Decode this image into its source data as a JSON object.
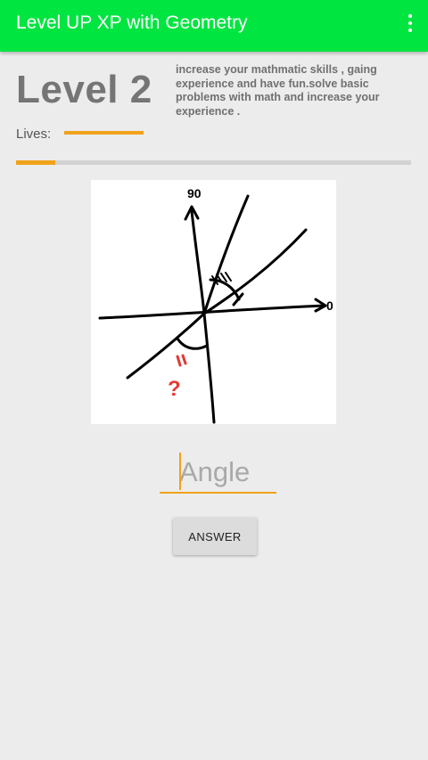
{
  "appbar": {
    "title": "Level UP XP with Geometry",
    "color": "#00e540",
    "menu_icon": "overflow-menu-icon"
  },
  "level": {
    "title": "Level 2",
    "description": "increase your mathmatic skills , gaing experience and have fun.solve basic problems with math and increase your experience ."
  },
  "lives": {
    "label": "Lives:",
    "fraction": 1.0,
    "color": "#f0a21a"
  },
  "progress": {
    "fraction": 0.1,
    "color": "#f0a21a"
  },
  "question_image": {
    "labels": [
      "90",
      "0",
      "?"
    ]
  },
  "answer_input": {
    "placeholder": "Angle",
    "value": ""
  },
  "answer_button": {
    "label": "ANSWER"
  }
}
